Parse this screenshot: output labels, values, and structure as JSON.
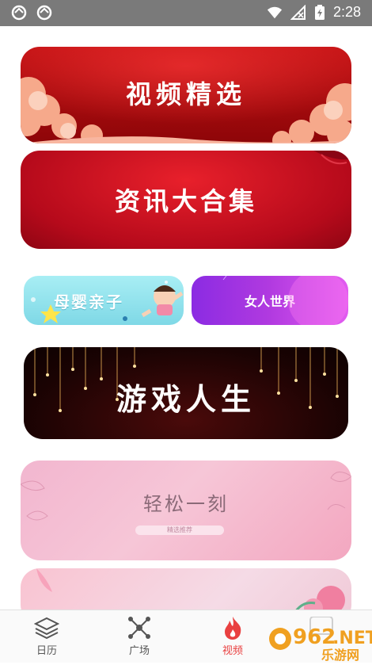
{
  "status_bar": {
    "time": "2:28"
  },
  "banners": {
    "video_select": "视频精选",
    "news": "资讯大合集",
    "mother_baby": "母婴亲子",
    "women_world": "女人世界",
    "game_life": "游戏人生",
    "relax": "轻松一刻",
    "relax_tag": "精选推荐"
  },
  "nav": {
    "items": [
      {
        "label": "日历",
        "icon": "layers-icon"
      },
      {
        "label": "广场",
        "icon": "network-icon"
      },
      {
        "label": "视频",
        "icon": "fire-icon"
      }
    ],
    "active": "视频"
  },
  "watermark": {
    "number": "962",
    "suffix": ".NET",
    "label": "乐游网"
  },
  "colors": {
    "accent": "#e94040",
    "status_bar": "#7a7a7a"
  }
}
